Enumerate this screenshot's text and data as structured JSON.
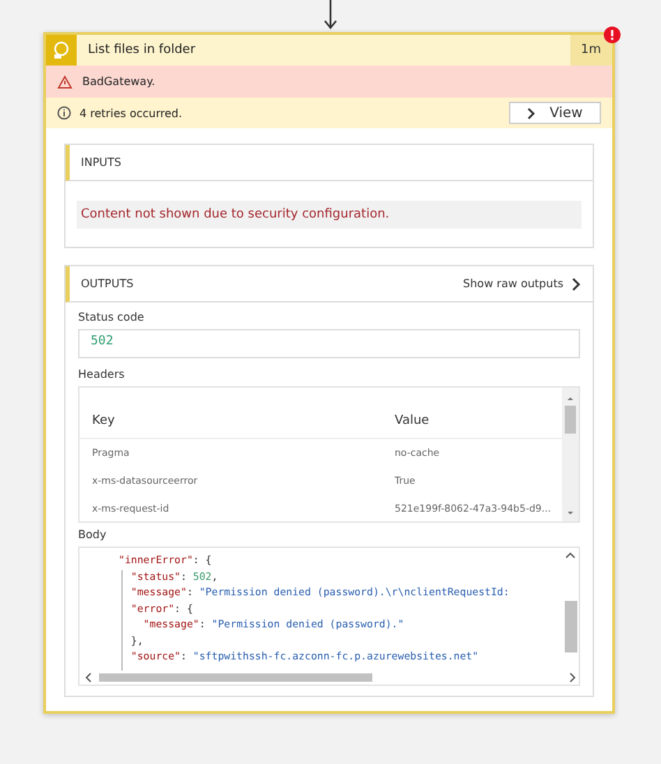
{
  "action": {
    "title": "List files in folder",
    "duration": "1m",
    "has_error": true
  },
  "error": {
    "message": "BadGateway."
  },
  "retries": {
    "message": "4 retries occurred.",
    "button": "View"
  },
  "inputs": {
    "heading": "INPUTS",
    "notice": "Content not shown due to security configuration."
  },
  "outputs": {
    "heading": "OUTPUTS",
    "raw_link": "Show raw outputs",
    "status_code": {
      "label": "Status code",
      "value": "502"
    },
    "headers": {
      "label": "Headers",
      "columns": [
        "Key",
        "Value"
      ],
      "rows": [
        {
          "key": "Pragma",
          "value": "no-cache"
        },
        {
          "key": "x-ms-datasourceerror",
          "value": "True"
        },
        {
          "key": "x-ms-request-id",
          "value": "521e199f-8062-47a3-94b5-d9..."
        }
      ]
    },
    "body": {
      "label": "Body",
      "lines": [
        [
          {
            "kind": "key",
            "text": "\"innerError\""
          },
          {
            "kind": "punct",
            "text": ": {"
          }
        ],
        [
          {
            "kind": "key",
            "text": "  \"status\""
          },
          {
            "kind": "punct",
            "text": ": "
          },
          {
            "kind": "number",
            "text": "502"
          },
          {
            "kind": "punct",
            "text": ","
          }
        ],
        [
          {
            "kind": "key",
            "text": "  \"message\""
          },
          {
            "kind": "punct",
            "text": ": "
          },
          {
            "kind": "string",
            "text": "\"Permission denied (password).\\r\\nclientRequestId:"
          }
        ],
        [
          {
            "kind": "key",
            "text": "  \"error\""
          },
          {
            "kind": "punct",
            "text": ": {"
          }
        ],
        [
          {
            "kind": "key",
            "text": "    \"message\""
          },
          {
            "kind": "punct",
            "text": ": "
          },
          {
            "kind": "string",
            "text": "\"Permission denied (password).\""
          }
        ],
        [
          {
            "kind": "punct",
            "text": "  },"
          }
        ],
        [
          {
            "kind": "key",
            "text": "  \"source\""
          },
          {
            "kind": "punct",
            "text": ": "
          },
          {
            "kind": "string",
            "text": "\"sftpwithssh-fc.azconn-fc.p.azurewebsites.net\""
          }
        ]
      ]
    }
  }
}
